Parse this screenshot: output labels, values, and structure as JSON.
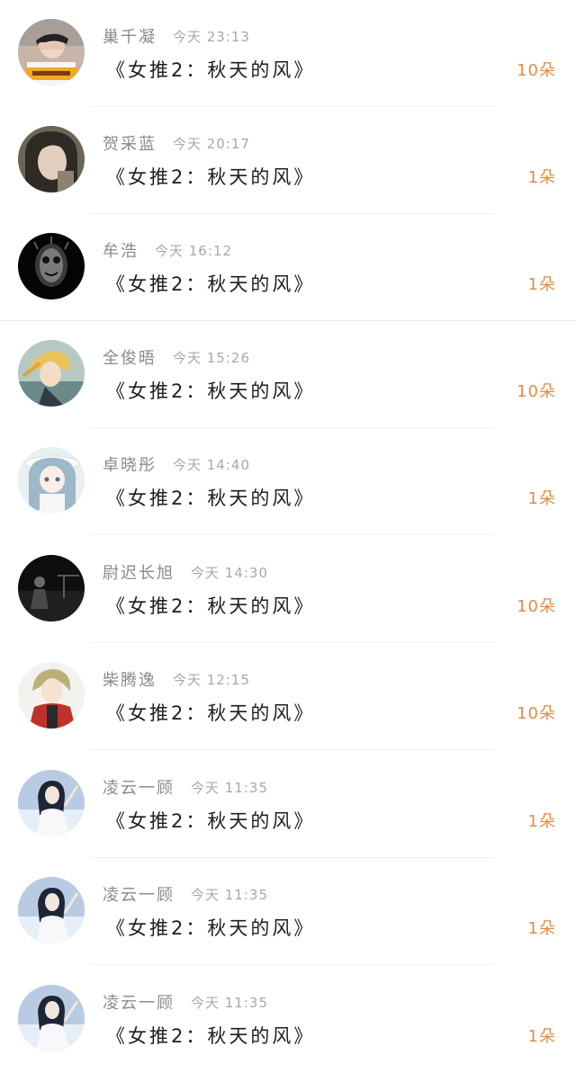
{
  "colors": {
    "name": "#8a8a8a",
    "time": "#a8a8a8",
    "title": "#1e1e1e",
    "amount_accent": "#e58a45"
  },
  "gifts": [
    {
      "avatar": "avatar-woman-hand-over-face",
      "name": "巢千凝",
      "time": "今天 23:13",
      "title": "《女推2：秋天的风》",
      "amount": "10朵"
    },
    {
      "avatar": "avatar-girl-dark-hair",
      "name": "贺采蓝",
      "time": "今天 20:17",
      "title": "《女推2：秋天的风》",
      "amount": "1朵"
    },
    {
      "avatar": "avatar-dark-mask",
      "name": "牟浩",
      "time": "今天 16:12",
      "title": "《女推2：秋天的风》",
      "amount": "1朵"
    },
    {
      "avatar": "avatar-anime-boy-blond",
      "name": "全俊晤",
      "time": "今天 15:26",
      "title": "《女推2：秋天的风》",
      "amount": "10朵"
    },
    {
      "avatar": "avatar-anime-girl-hat",
      "name": "卓晓彤",
      "time": "今天 14:40",
      "title": "《女推2：秋天的风》",
      "amount": "1朵"
    },
    {
      "avatar": "avatar-dark-night-figure",
      "name": "尉迟长旭",
      "time": "今天 14:30",
      "title": "《女推2：秋天的风》",
      "amount": "10朵"
    },
    {
      "avatar": "avatar-anime-red-jacket",
      "name": "柴腾逸",
      "time": "今天 12:15",
      "title": "《女推2：秋天的风》",
      "amount": "10朵"
    },
    {
      "avatar": "avatar-girl-white-dress",
      "name": "凌云一顾",
      "time": "今天 11:35",
      "title": "《女推2：秋天的风》",
      "amount": "1朵"
    },
    {
      "avatar": "avatar-girl-white-dress",
      "name": "凌云一顾",
      "time": "今天 11:35",
      "title": "《女推2：秋天的风》",
      "amount": "1朵"
    },
    {
      "avatar": "avatar-girl-white-dress",
      "name": "凌云一顾",
      "time": "今天 11:35",
      "title": "《女推2：秋天的风》",
      "amount": "1朵"
    }
  ]
}
